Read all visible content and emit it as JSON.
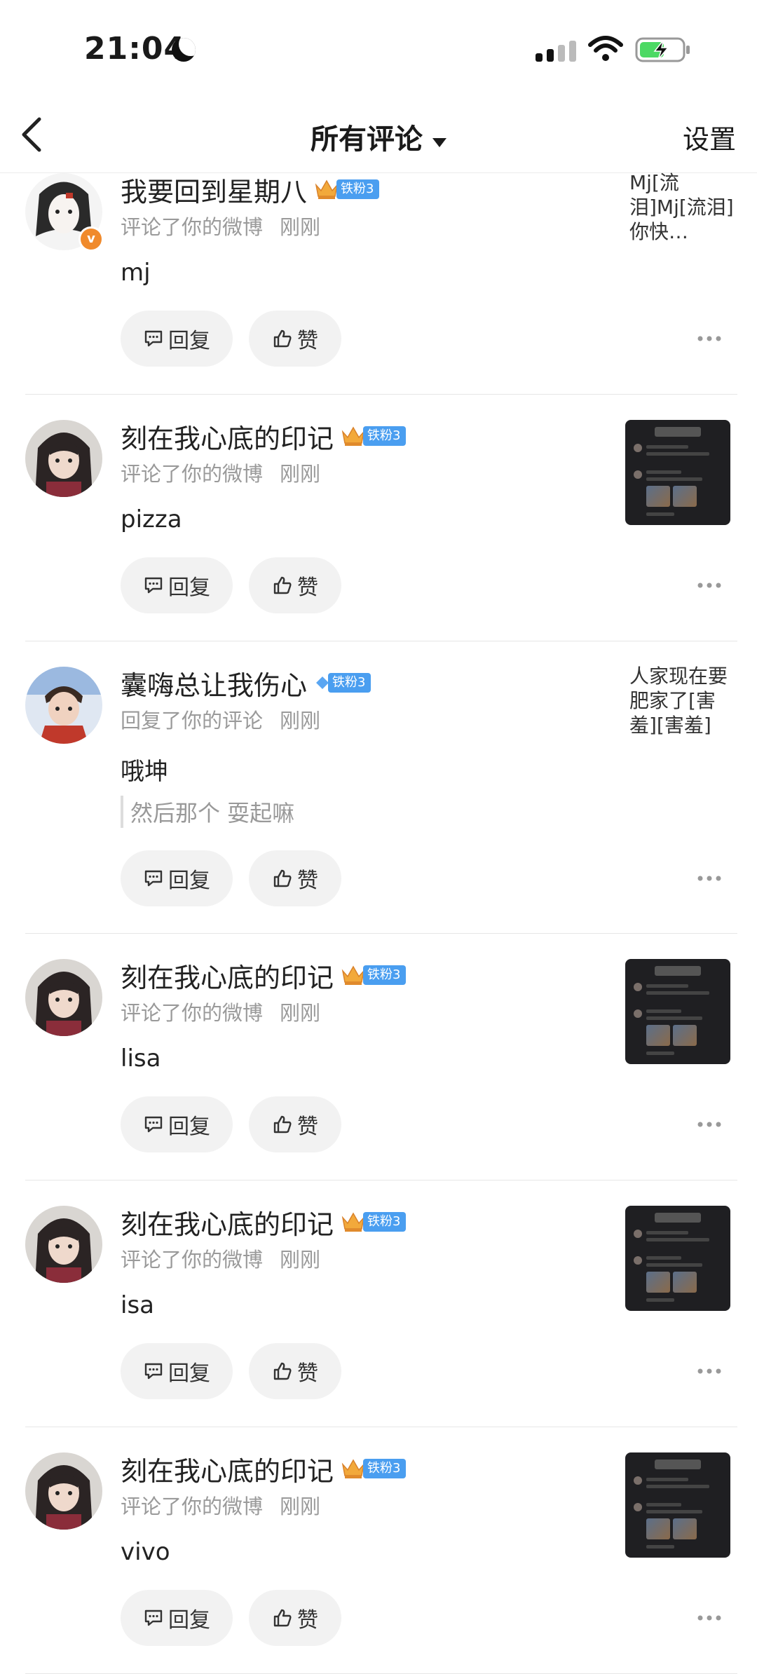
{
  "status_bar": {
    "time": "21:04"
  },
  "nav": {
    "title": "所有评论",
    "settings": "设置"
  },
  "actions": {
    "reply": "回复",
    "like": "赞"
  },
  "comments": [
    {
      "username": "我要回到星期八",
      "badge_type": "crown",
      "badge_label": "铁粉3",
      "action_text": "评论了你的微博",
      "time": "刚刚",
      "content": "mj",
      "quote": "",
      "preview_text": "Mj[流泪]Mj[流泪]你快…",
      "avatar_style": "sketch",
      "verified": true
    },
    {
      "username": "刻在我心底的印记",
      "badge_type": "crown",
      "badge_label": "铁粉3",
      "action_text": "评论了你的微博",
      "time": "刚刚",
      "content": "pizza",
      "quote": "",
      "preview_text": "",
      "avatar_style": "girl",
      "verified": false
    },
    {
      "username": "囊嗨总让我伤心",
      "badge_type": "diamond",
      "badge_label": "铁粉3",
      "action_text": "回复了你的评论",
      "time": "刚刚",
      "content": "哦坤",
      "quote": "然后那个 耍起嘛",
      "preview_text": "人家现在要肥家了[害羞][害羞]",
      "avatar_style": "boy",
      "verified": false
    },
    {
      "username": "刻在我心底的印记",
      "badge_type": "crown",
      "badge_label": "铁粉3",
      "action_text": "评论了你的微博",
      "time": "刚刚",
      "content": "lisa",
      "quote": "",
      "preview_text": "",
      "avatar_style": "girl",
      "verified": false
    },
    {
      "username": "刻在我心底的印记",
      "badge_type": "crown",
      "badge_label": "铁粉3",
      "action_text": "评论了你的微博",
      "time": "刚刚",
      "content": "isa",
      "quote": "",
      "preview_text": "",
      "avatar_style": "girl",
      "verified": false
    },
    {
      "username": "刻在我心底的印记",
      "badge_type": "crown",
      "badge_label": "铁粉3",
      "action_text": "评论了你的微博",
      "time": "刚刚",
      "content": "vivo",
      "quote": "",
      "preview_text": "",
      "avatar_style": "girl",
      "verified": false
    }
  ]
}
